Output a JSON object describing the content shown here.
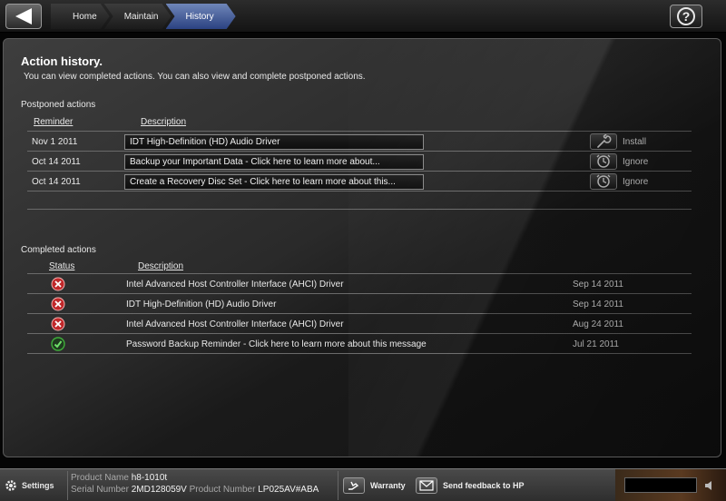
{
  "nav": {
    "breadcrumbs": [
      "Home",
      "Maintain",
      "History"
    ],
    "help_label": "?"
  },
  "page": {
    "title": "Action history.",
    "subtitle": "You can view completed actions. You can also view and complete postponed actions."
  },
  "postponed": {
    "label": "Postponed actions",
    "col_reminder": "Reminder",
    "col_description": "Description",
    "rows": [
      {
        "date": "Nov 1 2011",
        "description": "IDT High-Definition (HD) Audio Driver",
        "action": "Install",
        "icon": "wrench-icon"
      },
      {
        "date": "Oct 14 2011",
        "description": "Backup your Important Data  -  Click here to learn more about...",
        "action": "Ignore",
        "icon": "clock-icon"
      },
      {
        "date": "Oct 14 2011",
        "description": "Create a Recovery Disc Set  -  Click here to learn more about this...",
        "action": "Ignore",
        "icon": "clock-icon"
      }
    ]
  },
  "completed": {
    "label": "Completed actions",
    "col_status": "Status",
    "col_description": "Description",
    "rows": [
      {
        "status": "failed",
        "description": "Intel Advanced Host Controller Interface (AHCI) Driver",
        "date": "Sep 14 2011"
      },
      {
        "status": "failed",
        "description": "IDT High-Definition (HD) Audio Driver",
        "date": "Sep 14 2011"
      },
      {
        "status": "failed",
        "description": "Intel Advanced Host Controller Interface (AHCI) Driver",
        "date": "Aug 24 2011"
      },
      {
        "status": "success",
        "description": "Password Backup Reminder   -   Click here to learn more about this message",
        "date": "Jul 21 2011"
      }
    ]
  },
  "footer": {
    "settings_label": "Settings",
    "product_name_label": "Product Name",
    "product_name": "h8-1010t",
    "serial_label": "Serial Number",
    "serial": "2MD128059V",
    "product_number_label": "Product Number",
    "product_number": "LP025AV#ABA",
    "warranty_label": "Warranty",
    "feedback_label": "Send feedback to HP"
  },
  "colors": {
    "accent_active_tab": "#3b5396",
    "error_red": "#c0282a",
    "success_green": "#3fae3a"
  }
}
